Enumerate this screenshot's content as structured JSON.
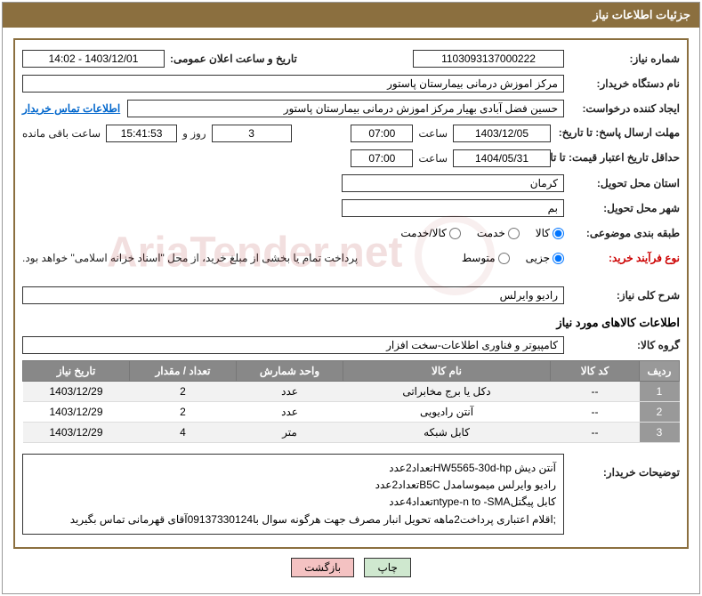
{
  "header": {
    "title": "جزئیات اطلاعات نیاز"
  },
  "fields": {
    "need_no_label": "شماره نیاز:",
    "need_no": "1103093137000222",
    "announce_date_label": "تاریخ و ساعت اعلان عمومی:",
    "announce_date": "1403/12/01 - 14:02",
    "buyer_org_label": "نام دستگاه خریدار:",
    "buyer_org": "مرکز اموزش درمانی بیمارستان پاستور",
    "requester_label": "ایجاد کننده درخواست:",
    "requester": "حسین فضل آبادی بهیار مرکز اموزش درمانی بیمارستان پاستور",
    "contact_link": "اطلاعات تماس خریدار",
    "reply_deadline_label": "مهلت ارسال پاسخ: تا تاریخ:",
    "reply_deadline_date": "1403/12/05",
    "hour_label": "ساعت",
    "reply_deadline_time": "07:00",
    "days_remaining": "3",
    "days_and_text": "روز و",
    "time_remaining": "15:41:53",
    "time_remaining_suffix": "ساعت باقی مانده",
    "price_valid_label": "حداقل تاریخ اعتبار قیمت: تا تاریخ:",
    "price_valid_date": "1404/05/31",
    "price_valid_time": "07:00",
    "province_label": "استان محل تحویل:",
    "province": "کرمان",
    "city_label": "شهر محل تحویل:",
    "city": "بم",
    "category_label": "طبقه بندی موضوعی:",
    "cat_goods": "کالا",
    "cat_service": "خدمت",
    "cat_goods_service": "کالا/خدمت",
    "process_label": "نوع فرآیند خرید:",
    "proc_small": "جزیی",
    "proc_medium": "متوسط",
    "process_note": "پرداخت تمام یا بخشی از مبلغ خرید، از محل \"اسناد خزانه اسلامی\" خواهد بود.",
    "summary_label": "شرح کلی نیاز:",
    "summary": "رادیو وایرلس",
    "goods_info_title": "اطلاعات کالاهای مورد نیاز",
    "goods_group_label": "گروه کالا:",
    "goods_group": "کامپیوتر و فناوری اطلاعات-سخت افزار",
    "buyer_desc_label": "توضیحات خریدار:",
    "buyer_desc_l1": "آنتن دیش HW5565-30d-hpتعداد2عدد",
    "buyer_desc_l2": "رادیو وایرلس میموسامدل B5Cتعداد2عدد",
    "buyer_desc_l3": "کابل پیگتلntype-n to -SMAتعداد4عدد",
    "buyer_desc_l4": ";اقلام اعتباری پرداخت2ماهه تحویل انبار مصرف جهت هرگونه سوال با09137330124آقای قهرمانی تماس بگیرید"
  },
  "table": {
    "headers": {
      "row": "ردیف",
      "code": "کد کالا",
      "name": "نام کالا",
      "unit": "واحد شمارش",
      "qty": "تعداد / مقدار",
      "date": "تاریخ نیاز"
    },
    "rows": [
      {
        "n": "1",
        "code": "--",
        "name": "دکل یا برج مخابراتی",
        "unit": "عدد",
        "qty": "2",
        "date": "1403/12/29"
      },
      {
        "n": "2",
        "code": "--",
        "name": "آنتن رادیویی",
        "unit": "عدد",
        "qty": "2",
        "date": "1403/12/29"
      },
      {
        "n": "3",
        "code": "--",
        "name": "کابل شبکه",
        "unit": "متر",
        "qty": "4",
        "date": "1403/12/29"
      }
    ]
  },
  "buttons": {
    "print": "چاپ",
    "back": "بازگشت"
  },
  "watermark": "AriaTender.net"
}
